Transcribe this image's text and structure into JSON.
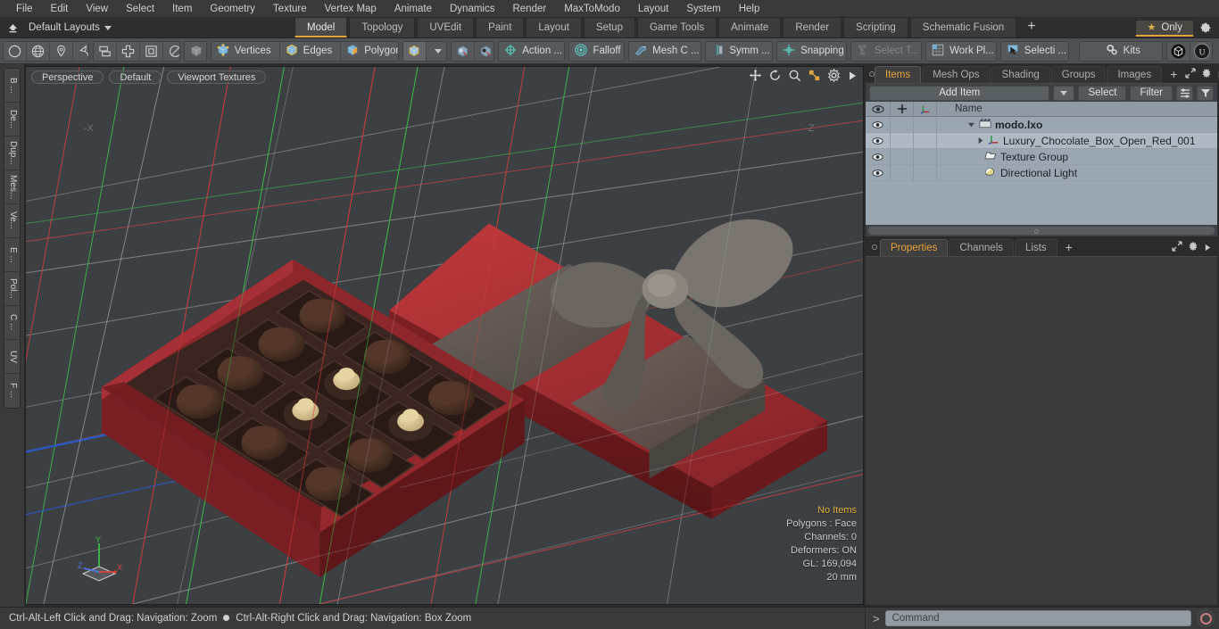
{
  "app": {
    "title": "modo",
    "accent": "#e2a33c",
    "viewport_bg": "#3c4043",
    "tree_bg": "#9aa6b1"
  },
  "menubar": {
    "items": [
      {
        "label": "File"
      },
      {
        "label": "Edit"
      },
      {
        "label": "View"
      },
      {
        "label": "Select"
      },
      {
        "label": "Item"
      },
      {
        "label": "Geometry"
      },
      {
        "label": "Texture"
      },
      {
        "label": "Vertex Map"
      },
      {
        "label": "Animate"
      },
      {
        "label": "Dynamics"
      },
      {
        "label": "Render"
      },
      {
        "label": "MaxToModo"
      },
      {
        "label": "Layout"
      },
      {
        "label": "System"
      },
      {
        "label": "Help"
      }
    ]
  },
  "layoutbar": {
    "up_icon": "up-arrow-icon",
    "layout_selector": "Default Layouts",
    "tabs": [
      {
        "label": "Model",
        "active": true
      },
      {
        "label": "Topology",
        "active": false
      },
      {
        "label": "UVEdit",
        "active": false
      },
      {
        "label": "Paint",
        "active": false
      },
      {
        "label": "Layout",
        "active": false
      },
      {
        "label": "Setup",
        "active": false
      },
      {
        "label": "Game Tools",
        "active": false
      },
      {
        "label": "Animate",
        "active": false
      },
      {
        "label": "Render",
        "active": false
      },
      {
        "label": "Scripting",
        "active": false
      },
      {
        "label": "Schematic Fusion",
        "active": false
      }
    ],
    "add_tab": "+",
    "only_label": "Only",
    "gear": "gear-icon"
  },
  "toolbar": {
    "groups": [
      {
        "name": "primitives",
        "buttons": [
          {
            "icon": "circle-icon",
            "label": ""
          },
          {
            "icon": "globe-icon",
            "label": ""
          },
          {
            "icon": "pen-icon",
            "label": ""
          },
          {
            "icon": "polygon-pen-icon",
            "label": ""
          }
        ]
      },
      {
        "name": "transforms",
        "buttons": [
          {
            "icon": "align-icon",
            "label": ""
          },
          {
            "icon": "move-icon",
            "label": ""
          },
          {
            "icon": "scale-icon",
            "label": ""
          },
          {
            "icon": "rotate-icon",
            "label": ""
          }
        ]
      },
      {
        "name": "item-mode",
        "buttons": [
          {
            "icon": "cube-grey-icon",
            "label": ""
          }
        ]
      },
      {
        "name": "component-modes",
        "buttons": [
          {
            "icon": "vertices-icon",
            "label": "Vertices"
          },
          {
            "icon": "edges-icon",
            "label": "Edges"
          },
          {
            "icon": "polygons-icon",
            "label": "Polygons"
          },
          {
            "icon": "items-icon",
            "label": ""
          }
        ]
      },
      {
        "name": "selection-dropdown",
        "buttons": [
          {
            "icon": "chevron-down-icon",
            "label": ""
          }
        ]
      },
      {
        "name": "center-pivot",
        "buttons": [
          {
            "icon": "center-cube-icon",
            "label": ""
          },
          {
            "icon": "pivot-cube-icon",
            "label": ""
          }
        ]
      },
      {
        "name": "action-center",
        "buttons": [
          {
            "icon": "action-center-icon",
            "label": "Action   ..."
          }
        ]
      },
      {
        "name": "falloff",
        "buttons": [
          {
            "icon": "falloff-icon",
            "label": "Falloff"
          }
        ]
      },
      {
        "name": "mesh-constraint",
        "buttons": [
          {
            "icon": "mesh-constraint-icon",
            "label": "Mesh C ..."
          }
        ]
      },
      {
        "name": "symmetry",
        "buttons": [
          {
            "icon": "symmetry-icon",
            "label": "Symm ..."
          }
        ]
      },
      {
        "name": "snapping",
        "buttons": [
          {
            "icon": "snapping-icon",
            "label": "Snapping"
          }
        ]
      },
      {
        "name": "select-through",
        "buttons": [
          {
            "icon": "select-through-icon",
            "label": "Select T...",
            "disabled": true
          }
        ]
      },
      {
        "name": "work-plane",
        "buttons": [
          {
            "icon": "work-plane-icon",
            "label": "Work Pl..."
          }
        ]
      },
      {
        "name": "selection-sets",
        "buttons": [
          {
            "icon": "selection-icon",
            "label": "Selecti  ..."
          }
        ]
      },
      {
        "name": "kits",
        "buttons": [
          {
            "icon": "kits-gears-icon",
            "label": "Kits"
          }
        ]
      },
      {
        "name": "exporters",
        "buttons": [
          {
            "icon": "unity-icon",
            "label": ""
          },
          {
            "icon": "unreal-icon",
            "label": ""
          }
        ]
      }
    ]
  },
  "left_strip": {
    "tabs": [
      {
        "label": "B ..."
      },
      {
        "label": "De..."
      },
      {
        "label": "Dup..."
      },
      {
        "label": "Mes..."
      },
      {
        "label": "Ve..."
      },
      {
        "label": "E ..."
      },
      {
        "label": "Pol..."
      },
      {
        "label": "C ..."
      },
      {
        "label": "UV"
      },
      {
        "label": "F ..."
      }
    ]
  },
  "viewport": {
    "view_mode": "Perspective",
    "shading_preset": "Default",
    "display_mode": "Viewport Textures",
    "header_icons": [
      "move-view-icon",
      "rotate-view-icon",
      "zoom-view-icon",
      "fit-view-icon",
      "settings-icon",
      "play-icon"
    ],
    "axis_labels": {
      "left": "-X",
      "right": "-Z"
    },
    "gizmo_axes": [
      "X",
      "Y",
      "Z"
    ],
    "stats": {
      "items": "No Items",
      "polygons": "Polygons : Face",
      "channels": "Channels: 0",
      "deformers": "Deformers: ON",
      "gl": "GL: 169,094",
      "scale": "20 mm"
    }
  },
  "items_panel": {
    "tabs": [
      {
        "label": "Items",
        "active": true
      },
      {
        "label": "Mesh Ops",
        "active": false
      },
      {
        "label": "Shading",
        "active": false
      },
      {
        "label": "Groups",
        "active": false
      },
      {
        "label": "Images",
        "active": false
      }
    ],
    "add_tab": "+",
    "add_item_label": "Add Item",
    "select_label": "Select",
    "filter_label": "Filter",
    "columns": [
      "eye-icon",
      "position-icon",
      "axis-icon",
      "Name"
    ],
    "name_column": "Name",
    "rows": [
      {
        "name": "modo.lxo",
        "icon": "scene-clapper-icon",
        "indent": 0,
        "bold": true,
        "expanded": true,
        "selected": false,
        "visible": true
      },
      {
        "name": "Luxury_Chocolate_Box_Open_Red_001",
        "icon": "mesh-axis-icon",
        "indent": 1,
        "bold": false,
        "expanded": false,
        "selected": true,
        "visible": true
      },
      {
        "name": "Texture Group",
        "icon": "folder-icon",
        "indent": 1,
        "bold": false,
        "expanded": null,
        "selected": false,
        "visible": true
      },
      {
        "name": "Directional Light",
        "icon": "light-icon",
        "indent": 1,
        "bold": false,
        "expanded": null,
        "selected": false,
        "visible": true
      }
    ]
  },
  "properties_panel": {
    "tabs": [
      {
        "label": "Properties",
        "active": true
      },
      {
        "label": "Channels",
        "active": false
      },
      {
        "label": "Lists",
        "active": false
      }
    ],
    "add_tab": "+"
  },
  "statusbar": {
    "hint_left": "Ctrl-Alt-Left Click and Drag: Navigation: Zoom",
    "hint_right": "Ctrl-Alt-Right Click and Drag: Navigation: Box Zoom",
    "command_prompt": ">",
    "command_placeholder": "Command",
    "record_button": "record-icon"
  }
}
